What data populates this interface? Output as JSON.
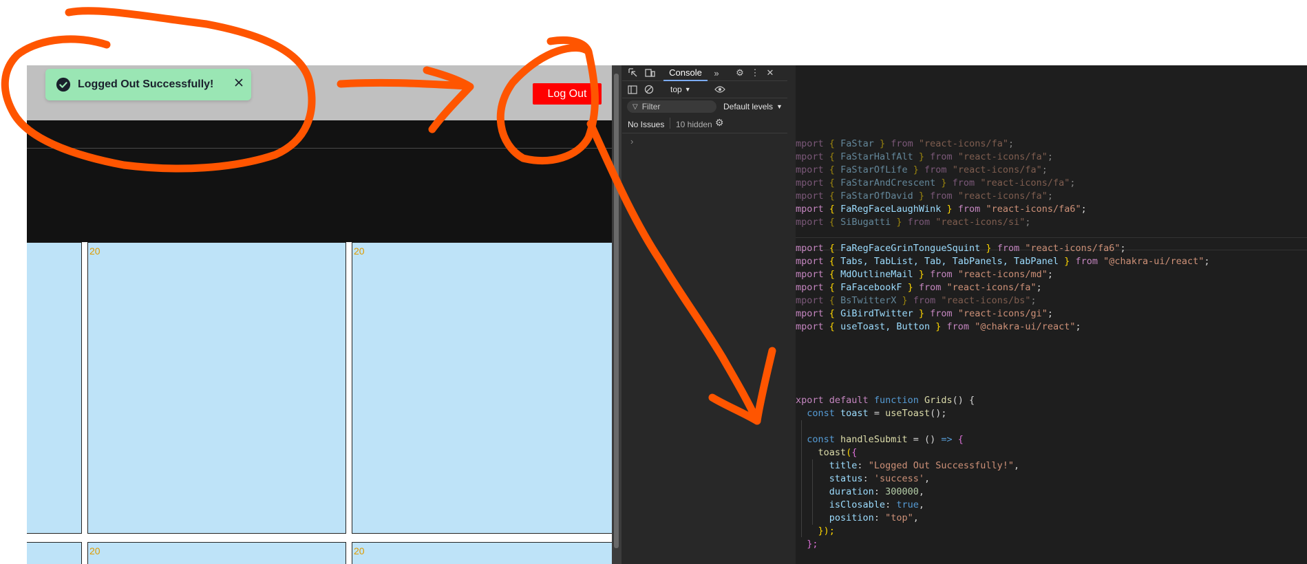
{
  "app": {
    "toast": {
      "title": "Logged Out Successfully!",
      "status_icon": "check-circle-icon",
      "close_icon": "close-icon"
    },
    "logout_label": "Log Out",
    "grid": {
      "cell_number": "20",
      "cell_color": "#bee3f8"
    }
  },
  "devtools": {
    "tab_label": "Console",
    "context_select": "top",
    "filter_placeholder": "Filter",
    "levels_label": "Default levels",
    "issues_label": "No Issues",
    "hidden_label": "10 hidden",
    "prompt": "›"
  },
  "editor": {
    "imports": [
      {
        "names": "FaStar",
        "source": "\"react-icons/fa\"",
        "dim": true
      },
      {
        "names": "FaStarHalfAlt",
        "source": "\"react-icons/fa\"",
        "dim": true
      },
      {
        "names": "FaStarOfLife",
        "source": "\"react-icons/fa\"",
        "dim": true
      },
      {
        "names": "FaStarAndCrescent",
        "source": "\"react-icons/fa\"",
        "dim": true
      },
      {
        "names": "FaStarOfDavid",
        "source": "\"react-icons/fa\"",
        "dim": true
      },
      {
        "names": "FaRegFaceLaughWink",
        "source": "\"react-icons/fa6\"",
        "dim": false
      },
      {
        "names": "SiBugatti",
        "source": "\"react-icons/si\"",
        "dim": true
      },
      {
        "names": "FaRegFaceGrinTongueSquint",
        "source": "\"react-icons/fa6\"",
        "dim": false
      },
      {
        "names": "Tabs, TabList, Tab, TabPanels, TabPanel",
        "source": "\"@chakra-ui/react\"",
        "dim": false
      },
      {
        "names": "MdOutlineMail",
        "source": "\"react-icons/md\"",
        "dim": false
      },
      {
        "names": "FaFacebookF",
        "source": "\"react-icons/fa\"",
        "dim": false
      },
      {
        "names": "BsTwitterX",
        "source": "\"react-icons/bs\"",
        "dim": true
      },
      {
        "names": "GiBirdTwitter",
        "source": "\"react-icons/gi\"",
        "dim": false
      },
      {
        "names": "useToast, Button",
        "source": "\"@chakra-ui/react\"",
        "dim": false
      }
    ],
    "import_kw": "mport",
    "from_kw": "from",
    "export_line": {
      "kw1": "xport",
      "kw2": "default",
      "kw3": "function",
      "name": "Grids",
      "rest": "() {"
    },
    "toast_decl": {
      "kw": "const",
      "name": "toast",
      "eq": " = ",
      "call": "useToast",
      "rest": "();"
    },
    "handler_decl": {
      "kw": "const",
      "name": "handleSubmit",
      "eq": " = () ",
      "arrow": "=>",
      "rest": " {"
    },
    "toast_call": "toast",
    "props": [
      {
        "key": "title",
        "value": "\"Logged Out Successfully!\"",
        "kind": "str"
      },
      {
        "key": "status",
        "value": "'success'",
        "kind": "str"
      },
      {
        "key": "duration",
        "value": "300000",
        "kind": "num"
      },
      {
        "key": "isClosable",
        "value": "true",
        "kind": "kw"
      },
      {
        "key": "position",
        "value": "\"top\"",
        "kind": "str"
      }
    ],
    "close_call": "});",
    "close_fn": "};"
  },
  "colors": {
    "annotation": "#ff5500",
    "toast_bg": "#9ae6b4",
    "logout_bg": "#ff0000"
  }
}
